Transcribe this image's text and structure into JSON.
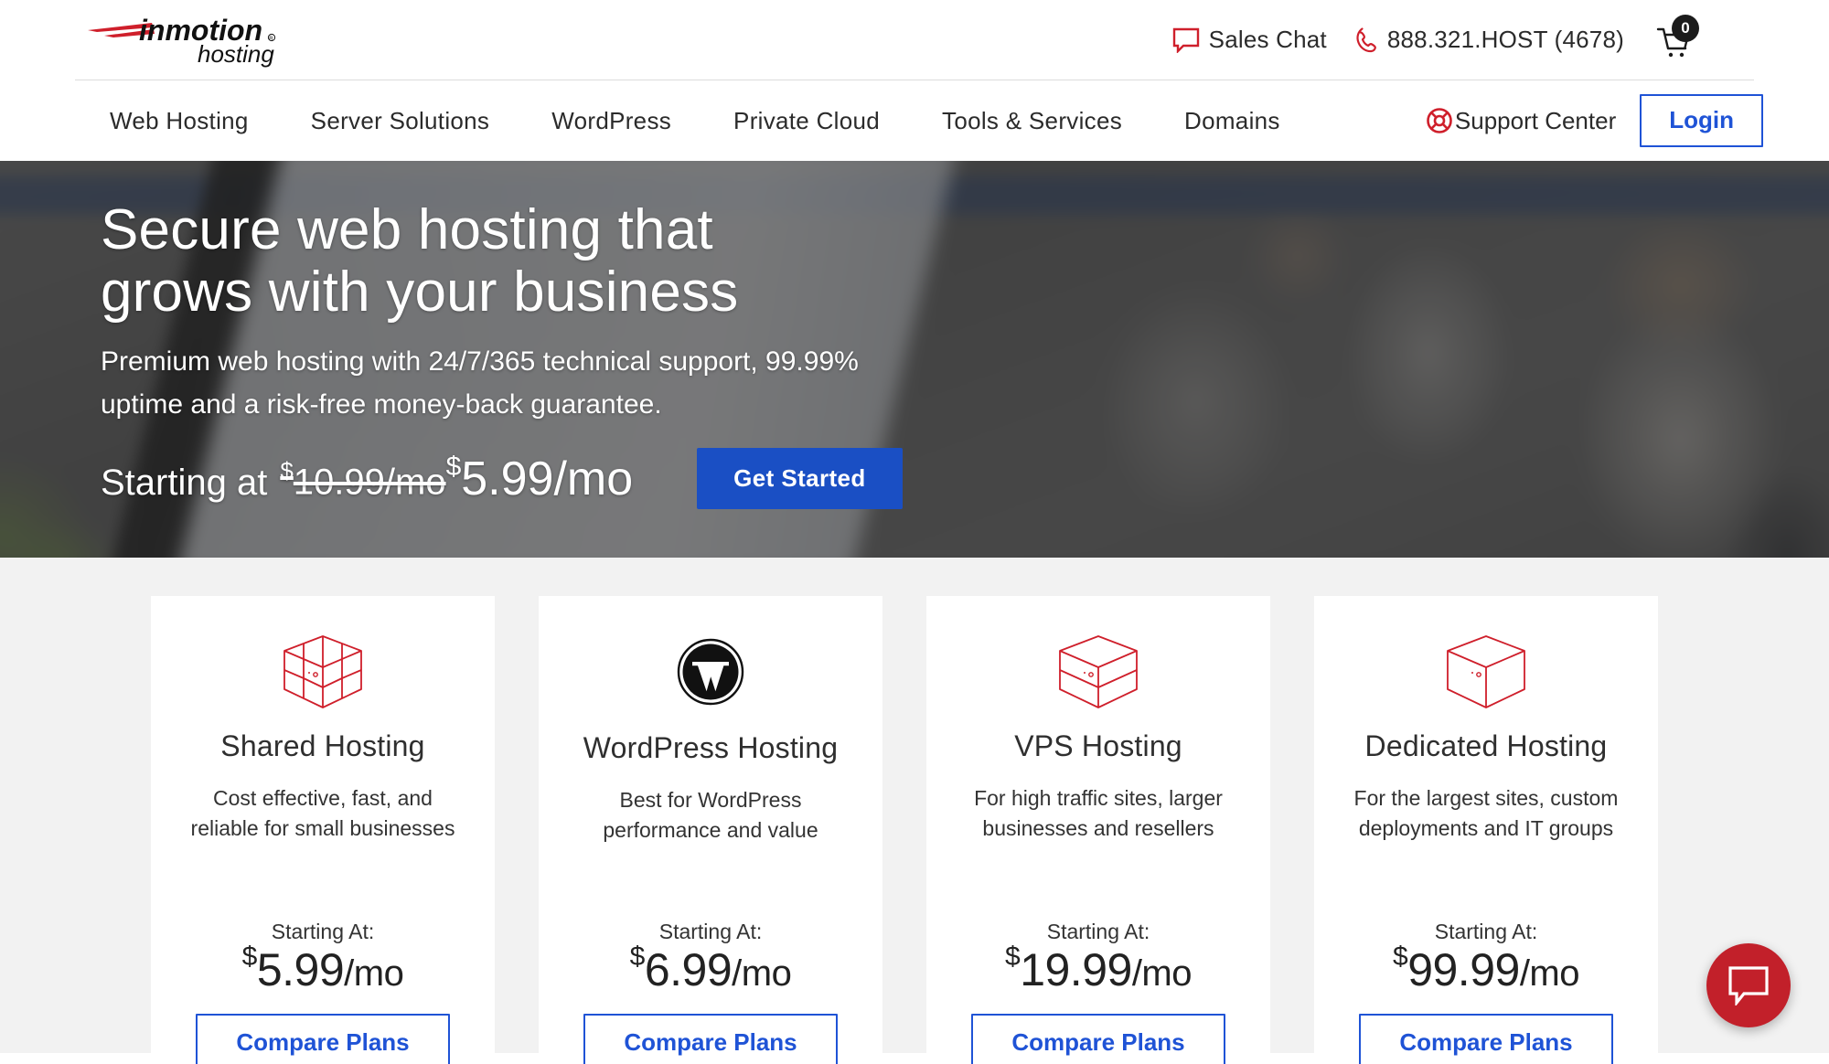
{
  "brand": {
    "logo_primary": "inmotion",
    "logo_secondary": "hosting",
    "registered_mark": "®",
    "accent_red": "#cf1f2b",
    "accent_blue": "#1f53d6",
    "hero_button_blue": "#1a4fc4",
    "page_bg": "#f2f2f2"
  },
  "topbar": {
    "sales_chat_label": "Sales Chat",
    "phone_label": "888.321.HOST (4678)",
    "cart_count": "0",
    "sales_chat_icon": "chat-bubble-icon",
    "phone_icon": "phone-icon",
    "cart_icon": "shopping-cart-icon"
  },
  "nav": {
    "items": [
      {
        "label": "Web Hosting"
      },
      {
        "label": "Server Solutions"
      },
      {
        "label": "WordPress"
      },
      {
        "label": "Private Cloud"
      },
      {
        "label": "Tools & Services"
      },
      {
        "label": "Domains"
      }
    ],
    "support_center_label": "Support Center",
    "support_center_icon": "life-ring-icon",
    "login_label": "Login"
  },
  "hero": {
    "heading_line1": "Secure web hosting that",
    "heading_line2": "grows with your business",
    "subheading_line1": "Premium web hosting with 24/7/365 technical support, 99.99%",
    "subheading_line2": "uptime and a risk-free money-back guarantee.",
    "price_lead": "Starting at",
    "price_old_dollar": "$",
    "price_old": "10.99/mo",
    "price_new_dollar": "$",
    "price_new": "5.99/mo",
    "cta_label": "Get Started"
  },
  "cards": [
    {
      "icon": "rubiks-cube-icon",
      "title": "Shared Hosting",
      "desc_line1": "Cost effective, fast, and",
      "desc_line2": "reliable for small businesses",
      "starting_at": "Starting At:",
      "price_dollar": "$",
      "price_amount": "5.99",
      "price_period": "/mo",
      "cta_label": "Compare Plans"
    },
    {
      "icon": "wordpress-logo-icon",
      "title": "WordPress Hosting",
      "desc_line1": "Best for WordPress",
      "desc_line2": "performance and value",
      "starting_at": "Starting At:",
      "price_dollar": "$",
      "price_amount": "6.99",
      "price_period": "/mo",
      "cta_label": "Compare Plans"
    },
    {
      "icon": "layered-cube-icon",
      "title": "VPS Hosting",
      "desc_line1": "For high traffic sites, larger",
      "desc_line2": "businesses and resellers",
      "starting_at": "Starting At:",
      "price_dollar": "$",
      "price_amount": "19.99",
      "price_period": "/mo",
      "cta_label": "Compare Plans"
    },
    {
      "icon": "solid-cube-icon",
      "title": "Dedicated Hosting",
      "desc_line1": "For the largest sites, custom",
      "desc_line2": "deployments and IT groups",
      "starting_at": "Starting At:",
      "price_dollar": "$",
      "price_amount": "99.99",
      "price_period": "/mo",
      "cta_label": "Compare Plans"
    }
  ],
  "chat_widget": {
    "icon": "chat-bubble-icon",
    "color": "#c2202a"
  }
}
